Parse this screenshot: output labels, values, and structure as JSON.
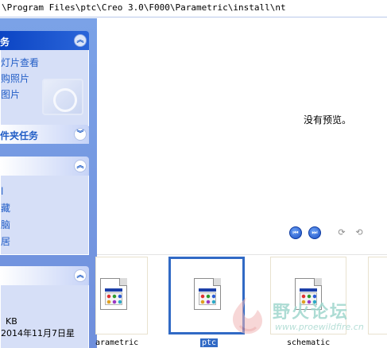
{
  "address": {
    "path": "\\Program Files\\ptc\\Creo 3.0\\F000\\Parametric\\install\\nt"
  },
  "taskpane": {
    "picture_tasks": {
      "title": "务",
      "items": [
        "灯片查看",
        "购照片",
        "图片"
      ]
    },
    "file_folder_tasks": {
      "title": "件夹任务"
    },
    "other_places": {
      "items": [
        "l",
        "藏",
        "脑",
        "居"
      ]
    },
    "details": {
      "size": "KB",
      "date": "2014年11月7日星"
    }
  },
  "preview": {
    "no_preview_text": "没有预览。"
  },
  "filmstrip": {
    "items": [
      {
        "label": "arametric"
      },
      {
        "label": "ptc"
      },
      {
        "label": "schematic"
      }
    ],
    "selected_index": 1
  },
  "watermark": {
    "site_name": "野火论坛",
    "url": "www.proewildfire.cn"
  },
  "colors": {
    "pane_blue": "#6f8fdc",
    "header_dark": "#0c45c4",
    "link_blue": "#215dc6",
    "selection_blue": "#316ac5",
    "nav_button": "#1b4fc4"
  }
}
